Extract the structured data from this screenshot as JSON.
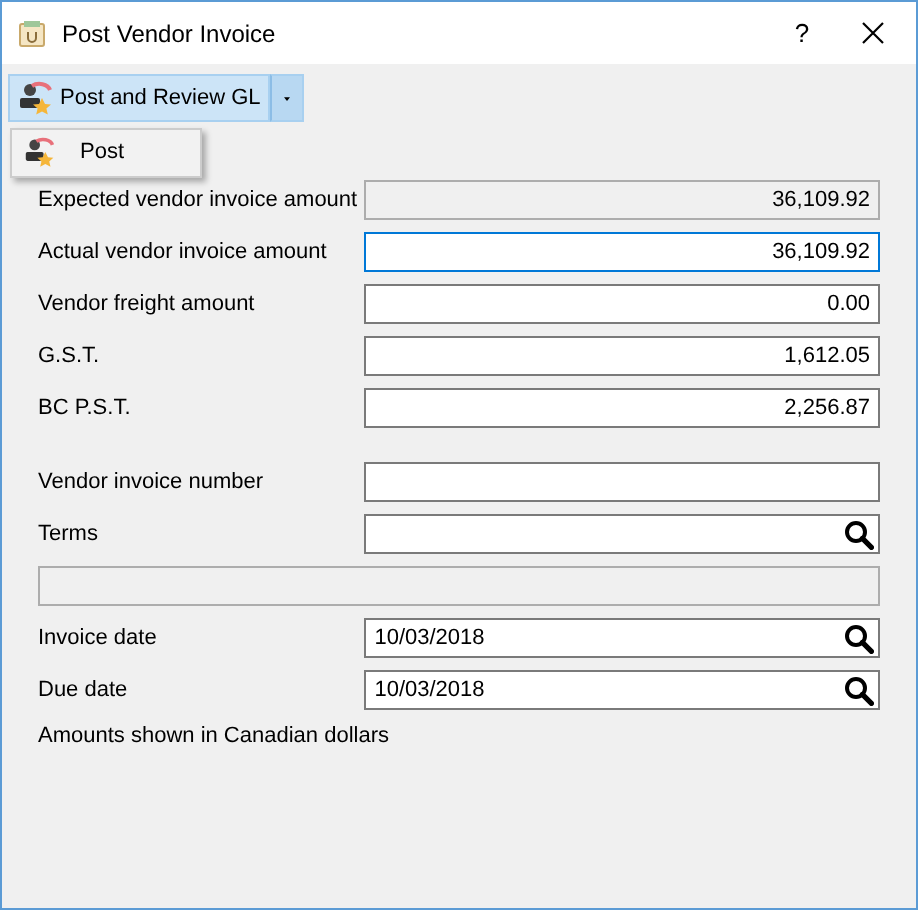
{
  "window": {
    "title": "Post Vendor Invoice",
    "help": "?"
  },
  "toolbar": {
    "button": "Post and Review GL"
  },
  "menu": [
    {
      "label": "Post"
    }
  ],
  "fields": [
    {
      "kind": "amount",
      "label": "Expected vendor invoice amount",
      "value": "36,109.92",
      "readonly": true,
      "focused": false
    },
    {
      "kind": "amount",
      "label": "Actual vendor invoice amount",
      "value": "36,109.92",
      "readonly": false,
      "focused": true
    },
    {
      "kind": "amount",
      "label": "Vendor freight amount",
      "value": "0.00",
      "readonly": false,
      "focused": false
    },
    {
      "kind": "amount",
      "label": "G.S.T.",
      "value": "1,612.05",
      "readonly": false,
      "focused": false
    },
    {
      "kind": "amount",
      "label": "BC P.S.T.",
      "value": "2,256.87",
      "readonly": false,
      "focused": false
    },
    {
      "kind": "gap"
    },
    {
      "kind": "text",
      "label": "Vendor invoice number",
      "readonly": false,
      "focused": false
    },
    {
      "kind": "lookup",
      "label": "Terms",
      "readonly": false,
      "focused": false
    },
    {
      "kind": "banner",
      "readonly": true,
      "focused": false
    },
    {
      "kind": "lookup",
      "label": "Invoice date",
      "value": "10/03/2018",
      "readonly": false,
      "focused": false
    },
    {
      "kind": "lookup",
      "label": "Due date",
      "value": "10/03/2018",
      "readonly": false,
      "focused": false
    }
  ],
  "note": "Amounts shown in Canadian dollars"
}
